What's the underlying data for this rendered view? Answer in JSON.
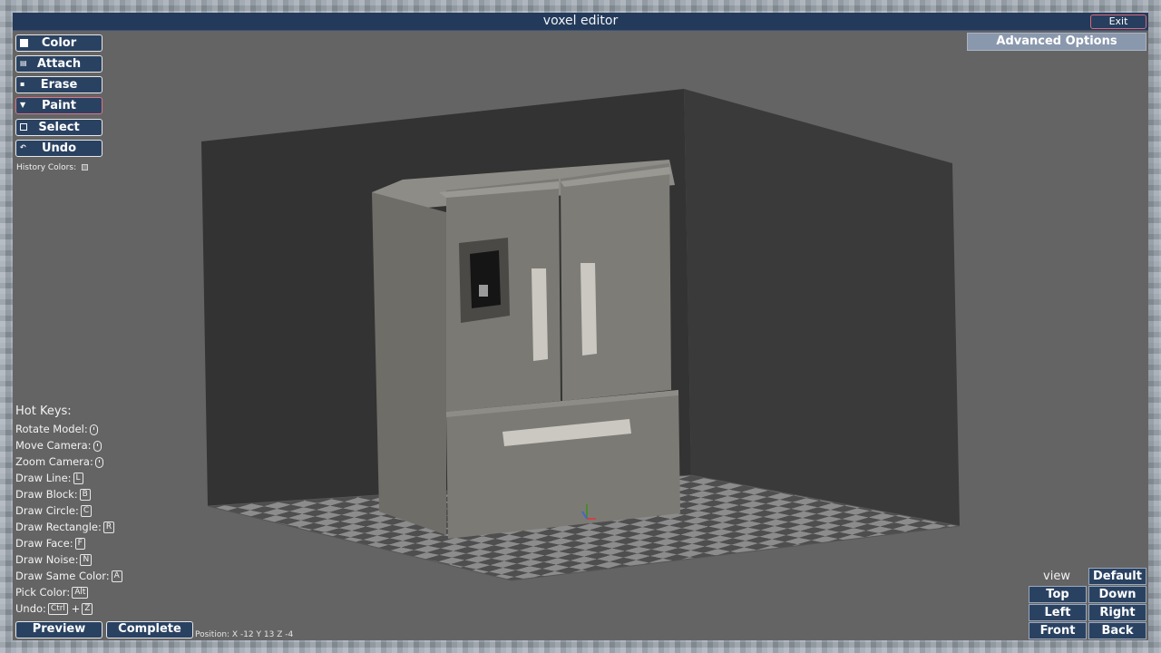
{
  "window": {
    "title": "voxel editor",
    "exit_label": "Exit"
  },
  "toolbar": {
    "tools": [
      {
        "label": "Color",
        "icon": "color-swatch-icon"
      },
      {
        "label": "Attach",
        "icon": "attach-icon"
      },
      {
        "label": "Erase",
        "icon": "eraser-icon"
      },
      {
        "label": "Paint",
        "icon": "paint-bucket-icon"
      },
      {
        "label": "Select",
        "icon": "select-box-icon"
      },
      {
        "label": "Undo",
        "icon": "undo-icon"
      }
    ],
    "active_tool": "Paint",
    "history_label": "History Colors:"
  },
  "advanced_options_label": "Advanced Options",
  "hotkeys": {
    "title": "Hot Keys:",
    "rows": [
      {
        "label": "Rotate Model:",
        "key": "",
        "icon": "mouse-left-icon"
      },
      {
        "label": "Move Camera:",
        "key": "",
        "icon": "mouse-right-icon"
      },
      {
        "label": "Zoom Camera:",
        "key": "",
        "icon": "mouse-wheel-icon"
      },
      {
        "label": "Draw Line:",
        "key": "L"
      },
      {
        "label": "Draw Block:",
        "key": "B"
      },
      {
        "label": "Draw Circle:",
        "key": "C"
      },
      {
        "label": "Draw Rectangle:",
        "key": "R"
      },
      {
        "label": "Draw Face:",
        "key": "F"
      },
      {
        "label": "Draw Noise:",
        "key": "N"
      },
      {
        "label": "Draw Same Color:",
        "key": "A"
      },
      {
        "label": "Pick Color:",
        "key": "Alt"
      },
      {
        "label": "Undo:",
        "key": "Ctrl",
        "plus": "+",
        "key2": "Z"
      }
    ]
  },
  "bottom": {
    "preview_label": "Preview",
    "complete_label": "Complete",
    "position_text": "Position: X -12 Y 13 Z -4"
  },
  "view": {
    "label": "view",
    "buttons": [
      "Default",
      "Top",
      "Down",
      "Left",
      "Right",
      "Front",
      "Back"
    ]
  },
  "colors": {
    "title_bar": "#233a5a",
    "button_bg": "#2a4262",
    "active_border": "#e07488",
    "viewport_bg": "#646464",
    "wall": "#333333",
    "fridge_body": "#7a7873",
    "floor_light": "#8c8c8c",
    "floor_dark": "#4e4e4e"
  }
}
